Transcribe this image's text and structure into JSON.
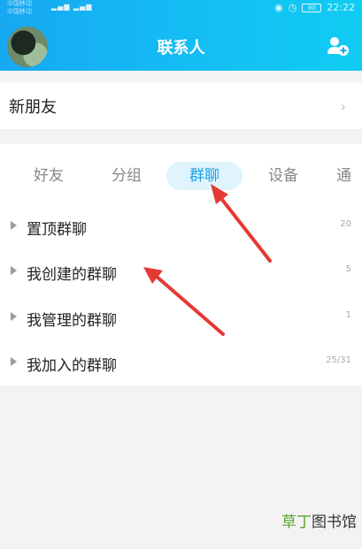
{
  "status_bar": {
    "carrier_line1": "中国移动",
    "carrier_line2": "中国移动",
    "time": "22:22",
    "battery": "80"
  },
  "header": {
    "title": "联系人"
  },
  "new_friends": {
    "label": "新朋友",
    "chevron": "›"
  },
  "tabs": [
    {
      "label": "好友",
      "active": false
    },
    {
      "label": "分组",
      "active": false
    },
    {
      "label": "群聊",
      "active": true
    },
    {
      "label": "设备",
      "active": false
    },
    {
      "label": "通",
      "active": false
    }
  ],
  "groups": [
    {
      "label": "置顶群聊",
      "count": "20"
    },
    {
      "label": "我创建的群聊",
      "count": "5"
    },
    {
      "label": "我管理的群聊",
      "count": "1"
    },
    {
      "label": "我加入的群聊",
      "count": "25/31"
    }
  ],
  "watermark": {
    "part1": "草丁",
    "part2": "图书馆"
  },
  "colors": {
    "header_blue": "#17a8f2",
    "active_tab": "#1ea0e6",
    "arrow_red": "#e53935"
  },
  "icons": {
    "add_contact": "add-contact-icon",
    "row_expand": "triangle-right-icon"
  }
}
